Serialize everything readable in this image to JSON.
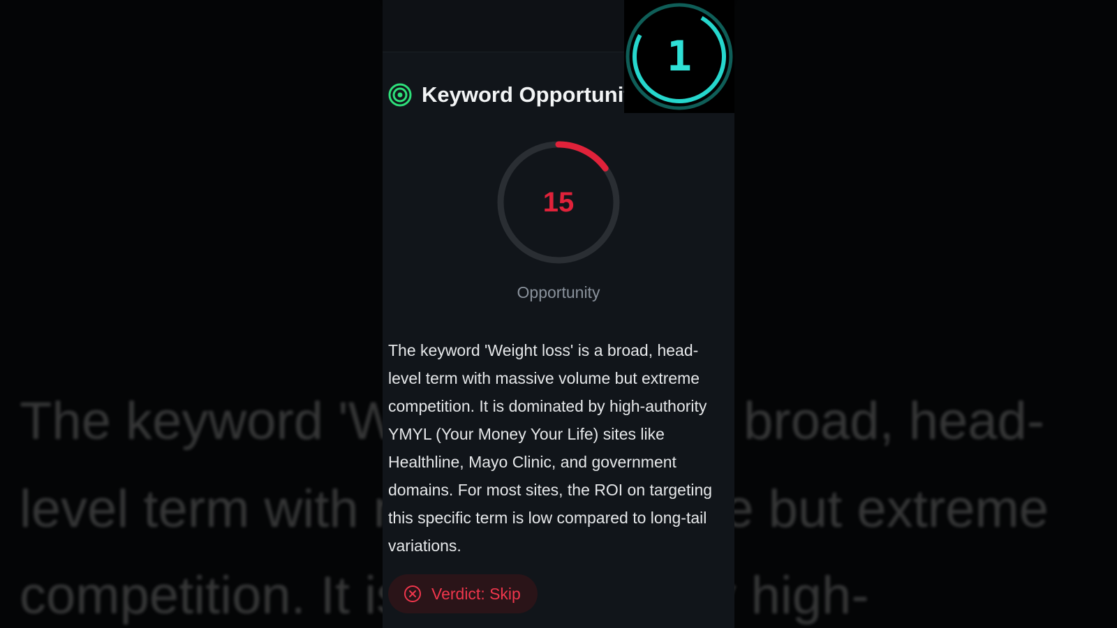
{
  "card": {
    "title": "Keyword Opportunity",
    "icon": "target-icon",
    "accent_color": "#2ee07a"
  },
  "score": {
    "value": "15",
    "label": "Opportunity",
    "fraction": 0.15,
    "color": "#e0223a",
    "track_color": "#2a2e33"
  },
  "description": "The keyword 'Weight loss' is a broad, head-level term with massive volume but extreme competition. It is dominated by high-authority YMYL (Your Money Your Life) sites like Healthline, Mayo Clinic, and government domains. For most sites, the ROI on targeting this specific term is low compared to long-tail variations.",
  "verdict": {
    "label": "Verdict: Skip",
    "icon": "x-circle-icon",
    "color": "#f0364c"
  },
  "timer": {
    "digit": "1",
    "color": "#2fe0d6"
  },
  "background": {
    "lines": [
      "The keyword 'Weight loss' is a broad, head-",
      "level term with massive volume but extreme",
      "competition. It is dominated by high-"
    ]
  }
}
